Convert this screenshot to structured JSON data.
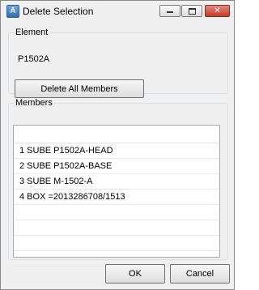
{
  "window": {
    "title": "Delete Selection",
    "controls": {
      "minimize": "minimize",
      "maximize": "maximize",
      "close": "✕"
    }
  },
  "element_group": {
    "legend": "Element",
    "value": "P1502A",
    "delete_all_label": "Delete All Members"
  },
  "members_group": {
    "legend": "Members",
    "rows": [
      "1 SUBE P1502A-HEAD",
      "2 SUBE P1502A-BASE",
      "3 SUBE M-1502-A",
      "4 BOX =2013286708/1513",
      "",
      "",
      "",
      ""
    ]
  },
  "footer": {
    "ok_label": "OK",
    "cancel_label": "Cancel"
  },
  "icons": {
    "app": "app-icon",
    "minimize": "minimize-icon",
    "maximize": "maximize-icon",
    "close": "close-icon"
  },
  "colors": {
    "close_button": "#c7392a",
    "window_bg": "#f0f0f0"
  }
}
